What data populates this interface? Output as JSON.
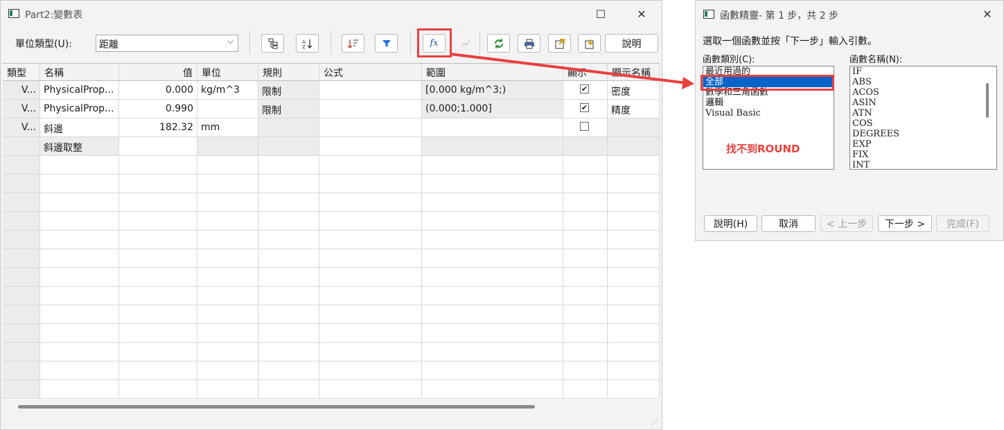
{
  "main_window": {
    "title": "Part2:變數表",
    "caption": {
      "maximize": "☐",
      "close": "✕"
    },
    "toolbar": {
      "unit_type_label": "單位類型(U):",
      "unit_type_value": "距離",
      "help_label": "說明"
    },
    "columns": [
      "類型",
      "名稱",
      "值",
      "單位",
      "規則",
      "公式",
      "範圍",
      "顯示",
      "顯示名稱"
    ],
    "rows": [
      {
        "type": "V...",
        "name": "PhysicalProp...",
        "value": "0.000",
        "unit": "kg/m^3",
        "rule": "限制",
        "formula": "",
        "range": "[0.000 kg/m^3;)",
        "display": "✔",
        "display_name": "密度"
      },
      {
        "type": "V...",
        "name": "PhysicalProp...",
        "value": "0.990",
        "unit": "",
        "rule": "限制",
        "formula": "",
        "range": "(0.000;1.000]",
        "display": "✔",
        "display_name": "精度"
      },
      {
        "type": "V...",
        "name": "斜邊",
        "value": "182.32",
        "unit": "mm",
        "rule": "",
        "formula": "",
        "range": "",
        "display": "",
        "display_name": ""
      },
      {
        "type": "",
        "name": "斜邊取整",
        "value": "",
        "unit": "",
        "rule": "",
        "formula": "",
        "range": "",
        "display": "",
        "display_name": ""
      }
    ]
  },
  "dialog": {
    "title": "函數精靈- 第 1 步，共 2 步",
    "close": "✕",
    "instruction": "選取一個函數並按「下一步」輸入引數。",
    "category_label": "函數類別(C):",
    "name_label": "函數名稱(N):",
    "categories": [
      "最近用過的",
      "全部",
      "數學和三角函數",
      "邏輯",
      "Visual Basic"
    ],
    "selected_category": "全部",
    "functions": [
      "IF",
      "ABS",
      "ACOS",
      "ASIN",
      "ATN",
      "COS",
      "DEGREES",
      "EXP",
      "FIX",
      "INT"
    ],
    "buttons": {
      "help": "說明(H)",
      "cancel": "取消",
      "prev": "< 上一步",
      "next": "下一步 >",
      "finish": "完成(F)"
    }
  },
  "annotation": {
    "note": "找不到ROUND",
    "color": "#e8403f"
  }
}
